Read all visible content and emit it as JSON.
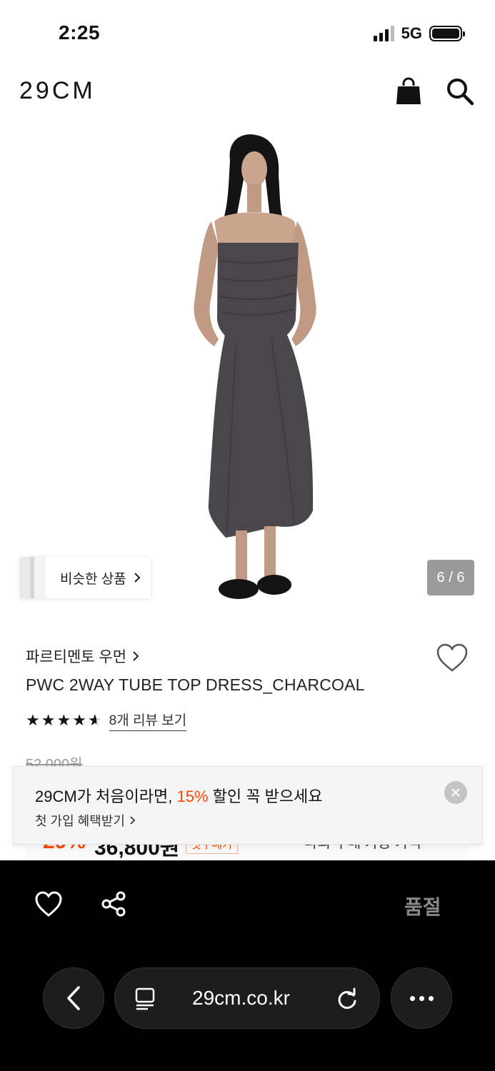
{
  "status_bar": {
    "time": "2:25",
    "network": "5G"
  },
  "header": {
    "logo": "29CM",
    "icons": [
      "shopping-bag-icon",
      "search-icon"
    ]
  },
  "gallery": {
    "similar_label": "비슷한 상품",
    "page_indicator": "6 / 6"
  },
  "product": {
    "brand": "파르티멘토 우먼",
    "name": "PWC 2WAY TUBE TOP DRESS_CHARCOAL",
    "rating": 4.5,
    "review_link": "8개 리뷰 보기",
    "original_price": "52,000원"
  },
  "price_partial": {
    "discount": "29%",
    "price": "36,800원",
    "coupon": "첫구매가",
    "max_benefit": "나의 구매 가능 가격"
  },
  "promo": {
    "title_before": "29CM가 처음이라면, ",
    "title_accent": "15%",
    "title_after": " 할인 꼭 받으세요",
    "subtitle": "첫 가입 혜택받기"
  },
  "bottom_bar": {
    "soldout_label": "품절"
  },
  "browser": {
    "url": "29cm.co.kr"
  },
  "colors": {
    "accent": "#ff4800",
    "bar_bg": "#000000",
    "dress": "#4a474c"
  }
}
